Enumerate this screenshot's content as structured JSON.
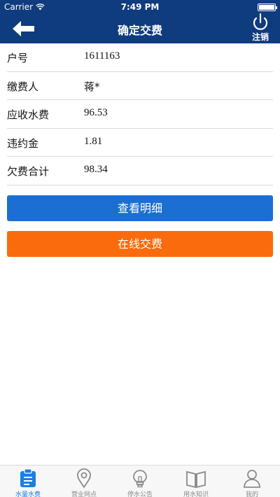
{
  "status_bar": {
    "carrier": "Carrier",
    "time": "7:49 PM"
  },
  "nav": {
    "title": "确定交费",
    "logout_label": "注销",
    "back_icon": "arrow-left-icon",
    "logout_icon": "power-icon"
  },
  "info": {
    "rows": [
      {
        "label": "户号",
        "value": "1611163"
      },
      {
        "label": "缴费人",
        "value": "蒋*"
      },
      {
        "label": "应收水费",
        "value": "96.53"
      },
      {
        "label": "违约金",
        "value": "1.81"
      },
      {
        "label": "欠费合计",
        "value": "98.34"
      }
    ]
  },
  "buttons": {
    "detail_label": "查看明细",
    "pay_label": "在线交费"
  },
  "tabs": [
    {
      "label": "水量水费",
      "icon": "clipboard-icon",
      "active": true
    },
    {
      "label": "营业网点",
      "icon": "location-pin-icon",
      "active": false
    },
    {
      "label": "停水公告",
      "icon": "lightbulb-icon",
      "active": false
    },
    {
      "label": "用水知识",
      "icon": "book-icon",
      "active": false
    },
    {
      "label": "我的",
      "icon": "person-icon",
      "active": false
    }
  ],
  "colors": {
    "nav_bg": "#0f3b7f",
    "detail_button": "#1b6fd2",
    "pay_button": "#f96b0d",
    "active_tab": "#1b7fe0"
  }
}
